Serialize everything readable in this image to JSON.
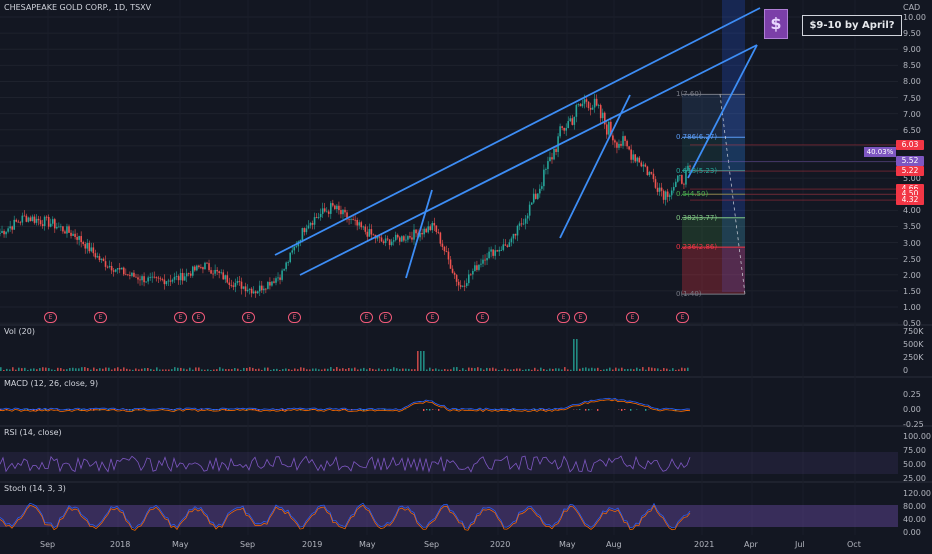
{
  "header": {
    "symbol": "CHESAPEAKE GOLD CORP., 1D, TSXV",
    "currency": "CAD"
  },
  "price_axis": {
    "ticks": [
      "10.00",
      "9.50",
      "9.00",
      "8.50",
      "8.00",
      "7.50",
      "7.00",
      "6.50",
      "6.00",
      "5.50",
      "5.00",
      "4.50",
      "4.00",
      "3.50",
      "3.00",
      "2.50",
      "2.00",
      "1.50",
      "1.00",
      "0.50"
    ]
  },
  "price_tags": [
    {
      "text": "6.03",
      "value": 6.03,
      "color": "#f23645"
    },
    {
      "text": "5.52",
      "value": 5.52,
      "color": "#7e57c2"
    },
    {
      "text": "5.22",
      "value": 5.22,
      "color": "#f23645"
    },
    {
      "text": "4.66",
      "value": 4.66,
      "color": "#f23645"
    },
    {
      "text": "4.50",
      "value": 4.5,
      "color": "#f23645"
    },
    {
      "text": "4.32",
      "value": 4.32,
      "color": "#f23645"
    }
  ],
  "pct_badge": "40.03%",
  "note": {
    "text": "$9-10 by April?",
    "icon": "dollar-icon",
    "icon_char": "$"
  },
  "fib": [
    {
      "label": "1(7.60)",
      "value": 7.6,
      "color": "#787b86"
    },
    {
      "label": "0.786(6.27)",
      "value": 6.27,
      "color": "#5b9cf6"
    },
    {
      "label": "0.618(5.23)",
      "value": 5.23,
      "color": "#26a69a"
    },
    {
      "label": "0.5(4.50)",
      "value": 4.5,
      "color": "#4caf50"
    },
    {
      "label": "0.382(3.77)",
      "value": 3.77,
      "color": "#81c784"
    },
    {
      "label": "0.236(2.86)",
      "value": 2.86,
      "color": "#f23645"
    },
    {
      "label": "0(1.40)",
      "value": 1.4,
      "color": "#787b86"
    }
  ],
  "time_axis": [
    "Sep",
    "2018",
    "May",
    "Sep",
    "2019",
    "May",
    "Sep",
    "2020",
    "May",
    "Aug",
    "2021",
    "Apr",
    "Jul",
    "Oct"
  ],
  "earnings_marker": "E",
  "panes": {
    "vol": {
      "title": "Vol (20)",
      "ticks": [
        "750K",
        "500K",
        "250K",
        "0"
      ]
    },
    "macd": {
      "title": "MACD (12, 26, close, 9)",
      "ticks": [
        "0.25",
        "0.00",
        "-0.25"
      ]
    },
    "rsi": {
      "title": "RSI (14, close)",
      "ticks": [
        "100.00",
        "75.00",
        "50.00",
        "25.00"
      ]
    },
    "stoch": {
      "title": "Stoch (14, 3, 3)",
      "ticks": [
        "120.00",
        "80.00",
        "40.00",
        "0.00"
      ]
    }
  },
  "chart_data": {
    "type": "line",
    "title": "CHESAPEAKE GOLD CORP., 1D, TSXV",
    "ylabel": "CAD",
    "ylim": [
      0.5,
      10.0
    ],
    "x": [
      "2017-08",
      "2017-10",
      "2018-01",
      "2018-03",
      "2018-05",
      "2018-07",
      "2018-09",
      "2018-11",
      "2019-01",
      "2019-03",
      "2019-05",
      "2019-06",
      "2019-07",
      "2019-08",
      "2019-09",
      "2019-10",
      "2019-12",
      "2020-01",
      "2020-03",
      "2020-04",
      "2020-05",
      "2020-06",
      "2020-07",
      "2020-08",
      "2020-09",
      "2020-10",
      "2020-11",
      "2020-12"
    ],
    "series": [
      {
        "values": [
          3.3,
          3.8,
          3.6,
          3.2,
          2.4,
          2.0,
          1.8,
          1.9,
          2.3,
          1.8,
          1.5,
          2.0,
          3.6,
          4.1,
          3.5,
          3.0,
          3.2,
          3.5,
          1.6,
          2.6,
          3.0,
          4.5,
          6.5,
          7.5,
          6.3,
          5.6,
          4.5,
          5.2
        ]
      }
    ]
  }
}
